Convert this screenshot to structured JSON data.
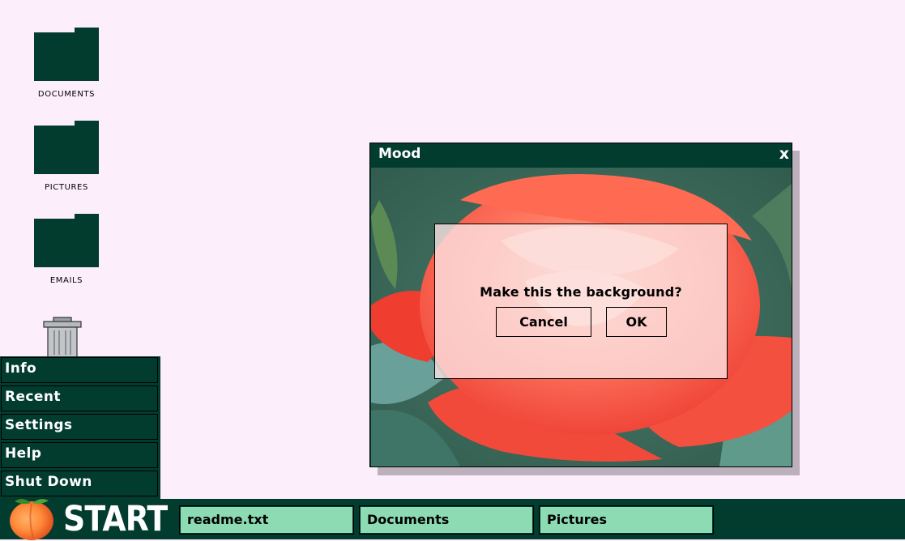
{
  "desktop": {
    "icons": [
      {
        "label": "DOCUMENTS",
        "icon": "folder-icon"
      },
      {
        "label": "PICTURES",
        "icon": "folder-icon"
      },
      {
        "label": "EMAILS",
        "icon": "folder-icon"
      },
      {
        "label": "",
        "icon": "trash-icon"
      }
    ]
  },
  "start_menu": {
    "items": [
      "Info",
      "Recent",
      "Settings",
      "Help",
      "Shut Down"
    ]
  },
  "taskbar": {
    "start_label": "START",
    "start_icon": "peach-icon",
    "tasks": [
      "readme.txt",
      "Documents",
      "Pictures"
    ]
  },
  "window": {
    "title": "Mood",
    "close_label": "x",
    "image": "rose-photo"
  },
  "dialog": {
    "message": "Make this the background?",
    "cancel_label": "Cancel",
    "ok_label": "OK"
  },
  "colors": {
    "desktop_bg": "#fdeefb",
    "dark_green": "#023c2f",
    "task_green": "#8ddbb3"
  }
}
